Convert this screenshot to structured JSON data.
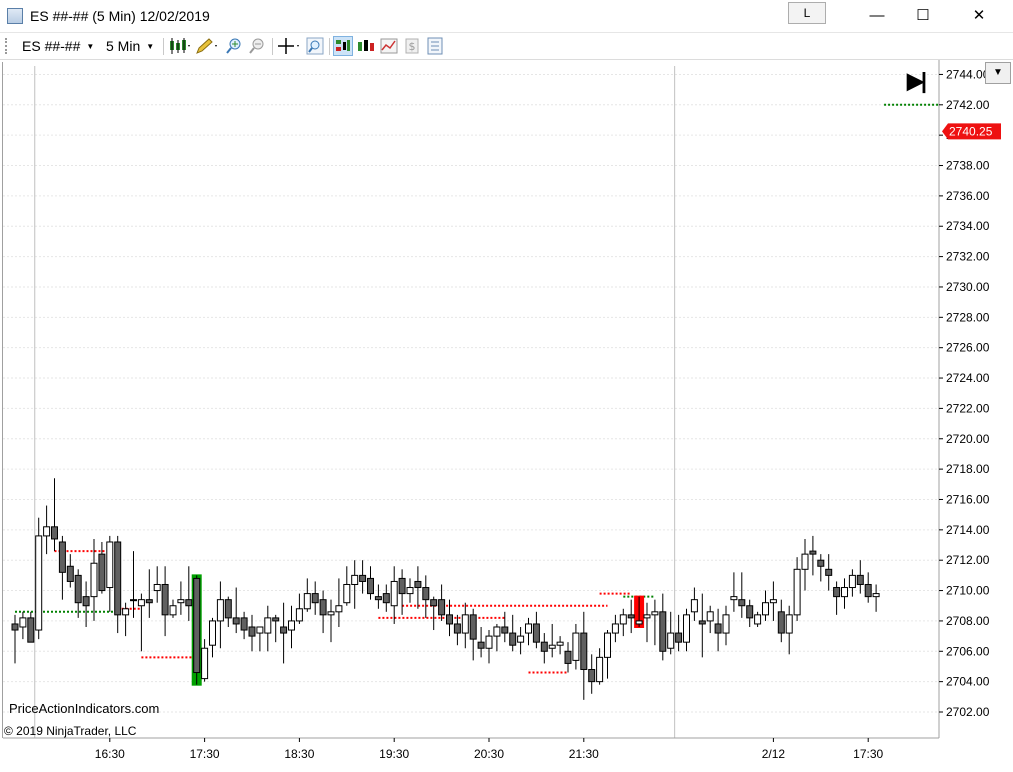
{
  "window": {
    "title": "ES ##-## (5 Min)  12/02/2019",
    "link_label": "L",
    "minimize_glyph": "—",
    "maximize_glyph": "☐",
    "close_glyph": "✕"
  },
  "toolbar": {
    "instrument": "ES ##-##",
    "interval": "5 Min",
    "icons": [
      "candlestick-chart-icon",
      "drawing-pencil-icon",
      "zoom-in-icon",
      "zoom-out-icon",
      "crosshair-icon",
      "magnifier-icon",
      "chart-trader-icon",
      "strategies-icon",
      "indicators-icon",
      "dollar-icon",
      "properties-icon"
    ]
  },
  "overlay": {
    "watermark": "PriceActionIndicators.com",
    "copyright": "© 2019 NinjaTrader, LLC",
    "go_to_end_glyph": "▶|"
  },
  "chart_data": {
    "type": "candlestick",
    "title": "",
    "ylim": [
      2700.5,
      2744.5
    ],
    "yticks": [
      2702,
      2704,
      2706,
      2708,
      2710,
      2712,
      2714,
      2716,
      2718,
      2720,
      2722,
      2724,
      2726,
      2728,
      2730,
      2732,
      2734,
      2736,
      2738,
      2740,
      2742,
      2744
    ],
    "ytick_labels": [
      "2702.00",
      "2704.00",
      "2706.00",
      "2708.00",
      "2710.00",
      "2712.00",
      "2714.00",
      "2716.00",
      "2718.00",
      "2720.00",
      "2722.00",
      "2724.00",
      "2726.00",
      "2728.00",
      "2730.00",
      "2732.00",
      "2734.00",
      "2736.00",
      "2738.00",
      "2740.00",
      "2742.00",
      "2744.00"
    ],
    "xticks": [
      {
        "i": 12,
        "label": "16:30"
      },
      {
        "i": 24,
        "label": "17:30"
      },
      {
        "i": 36,
        "label": "18:30"
      },
      {
        "i": 48,
        "label": "19:30"
      },
      {
        "i": 60,
        "label": "20:30"
      },
      {
        "i": 72,
        "label": "21:30"
      },
      {
        "i": 96,
        "label": "2/12"
      },
      {
        "i": 108,
        "label": "17:30"
      }
    ],
    "session_breaks": [
      2,
      83
    ],
    "last_price": 2740.25,
    "last_price_label": "2740.25",
    "colors": {
      "up": "#ffffff",
      "down": "#606060",
      "wick": "#000000",
      "red_level": "#ff0000",
      "green_level": "#008000",
      "highlight_red": "#ff0000",
      "highlight_green": "#00a000",
      "grid": "#e6e6e6"
    },
    "candles": [
      [
        2707.8,
        2708.4,
        2705.2,
        2707.4
      ],
      [
        2707.6,
        2708.6,
        2706.8,
        2708.2
      ],
      [
        2708.2,
        2708.6,
        2706.6,
        2706.6
      ],
      [
        2707.4,
        2714.8,
        2706.8,
        2713.6
      ],
      [
        2713.6,
        2715.6,
        2712.4,
        2714.2
      ],
      [
        2714.2,
        2717.4,
        2712.6,
        2713.4
      ],
      [
        2713.2,
        2713.6,
        2709.4,
        2711.2
      ],
      [
        2711.6,
        2712.4,
        2710.2,
        2710.6
      ],
      [
        2711.0,
        2711.4,
        2708.2,
        2709.2
      ],
      [
        2709.6,
        2710.6,
        2707.6,
        2709.0
      ],
      [
        2709.6,
        2713.4,
        2708.0,
        2711.8
      ],
      [
        2712.4,
        2713.2,
        2709.8,
        2710.0
      ],
      [
        2710.2,
        2713.6,
        2708.6,
        2713.2
      ],
      [
        2713.2,
        2713.6,
        2707.2,
        2708.4
      ],
      [
        2708.4,
        2709.2,
        2707.0,
        2708.8
      ],
      [
        2709.4,
        2712.6,
        2708.2,
        2709.4
      ],
      [
        2709.0,
        2709.8,
        2706.0,
        2709.4
      ],
      [
        2709.4,
        2711.4,
        2708.2,
        2709.2
      ],
      [
        2710.0,
        2711.6,
        2709.2,
        2710.4
      ],
      [
        2710.4,
        2711.6,
        2707.0,
        2708.4
      ],
      [
        2708.4,
        2709.4,
        2708.2,
        2709.0
      ],
      [
        2709.2,
        2710.6,
        2708.4,
        2709.4
      ],
      [
        2709.4,
        2711.6,
        2708.0,
        2709.0
      ],
      [
        2710.8,
        2711.0,
        2703.8,
        2704.6
      ],
      [
        2704.2,
        2706.8,
        2704.0,
        2706.2
      ],
      [
        2706.4,
        2708.2,
        2705.6,
        2708.0
      ],
      [
        2708.0,
        2710.6,
        2706.2,
        2709.4
      ],
      [
        2709.4,
        2709.6,
        2707.6,
        2708.2
      ],
      [
        2708.2,
        2710.2,
        2707.2,
        2707.8
      ],
      [
        2708.2,
        2708.6,
        2706.8,
        2707.4
      ],
      [
        2707.6,
        2708.4,
        2706.0,
        2707.0
      ],
      [
        2707.2,
        2707.6,
        2706.0,
        2707.6
      ],
      [
        2707.2,
        2709.0,
        2706.0,
        2708.2
      ],
      [
        2708.2,
        2708.4,
        2706.6,
        2708.0
      ],
      [
        2707.6,
        2709.2,
        2705.2,
        2707.2
      ],
      [
        2707.4,
        2709.0,
        2706.2,
        2708.0
      ],
      [
        2708.0,
        2709.8,
        2707.8,
        2708.8
      ],
      [
        2708.8,
        2710.8,
        2708.6,
        2709.8
      ],
      [
        2709.8,
        2710.6,
        2708.4,
        2709.2
      ],
      [
        2709.4,
        2710.0,
        2707.2,
        2708.4
      ],
      [
        2708.4,
        2709.4,
        2706.6,
        2708.6
      ],
      [
        2708.6,
        2710.8,
        2707.6,
        2709.0
      ],
      [
        2709.2,
        2711.6,
        2709.0,
        2710.4
      ],
      [
        2710.4,
        2712.0,
        2708.8,
        2711.0
      ],
      [
        2711.0,
        2712.0,
        2709.8,
        2710.6
      ],
      [
        2710.8,
        2711.6,
        2709.4,
        2709.8
      ],
      [
        2709.6,
        2710.4,
        2708.8,
        2709.4
      ],
      [
        2709.8,
        2710.4,
        2708.6,
        2709.2
      ],
      [
        2709.0,
        2711.6,
        2707.8,
        2710.6
      ],
      [
        2710.8,
        2711.4,
        2708.4,
        2709.8
      ],
      [
        2709.8,
        2710.8,
        2709.2,
        2710.2
      ],
      [
        2710.6,
        2711.6,
        2708.8,
        2710.2
      ],
      [
        2710.2,
        2711.0,
        2708.2,
        2709.4
      ],
      [
        2709.4,
        2709.6,
        2707.4,
        2709.0
      ],
      [
        2709.4,
        2710.4,
        2708.0,
        2708.4
      ],
      [
        2708.4,
        2709.4,
        2707.0,
        2707.8
      ],
      [
        2707.8,
        2708.4,
        2706.4,
        2707.2
      ],
      [
        2707.2,
        2709.2,
        2706.2,
        2708.4
      ],
      [
        2708.4,
        2708.8,
        2705.4,
        2706.8
      ],
      [
        2706.6,
        2707.6,
        2705.6,
        2706.2
      ],
      [
        2706.2,
        2707.4,
        2705.2,
        2707.0
      ],
      [
        2707.0,
        2707.8,
        2706.0,
        2707.6
      ],
      [
        2707.6,
        2708.6,
        2706.6,
        2707.2
      ],
      [
        2707.2,
        2708.4,
        2706.0,
        2706.4
      ],
      [
        2706.6,
        2707.6,
        2705.8,
        2707.0
      ],
      [
        2707.2,
        2708.2,
        2706.4,
        2707.8
      ],
      [
        2707.8,
        2708.6,
        2706.2,
        2706.6
      ],
      [
        2706.6,
        2707.2,
        2705.2,
        2706.0
      ],
      [
        2706.2,
        2707.8,
        2705.6,
        2706.4
      ],
      [
        2706.4,
        2707.0,
        2705.8,
        2706.6
      ],
      [
        2706.0,
        2706.6,
        2704.6,
        2705.2
      ],
      [
        2705.4,
        2707.8,
        2704.8,
        2707.2
      ],
      [
        2707.2,
        2708.6,
        2702.8,
        2704.8
      ],
      [
        2704.8,
        2705.8,
        2703.2,
        2704.0
      ],
      [
        2704.0,
        2706.2,
        2703.8,
        2705.6
      ],
      [
        2705.6,
        2707.4,
        2704.2,
        2707.2
      ],
      [
        2707.2,
        2708.4,
        2706.6,
        2707.8
      ],
      [
        2707.8,
        2708.8,
        2707.0,
        2708.4
      ],
      [
        2708.4,
        2709.4,
        2707.2,
        2708.2
      ],
      [
        2707.8,
        2709.6,
        2707.6,
        2708.0
      ],
      [
        2708.2,
        2709.2,
        2706.6,
        2708.4
      ],
      [
        2708.4,
        2709.4,
        2706.4,
        2708.6
      ],
      [
        2708.6,
        2709.8,
        2705.4,
        2706.0
      ],
      [
        2706.2,
        2708.6,
        2705.8,
        2707.2
      ],
      [
        2707.2,
        2708.4,
        2706.0,
        2706.6
      ],
      [
        2706.6,
        2708.8,
        2706.0,
        2708.4
      ],
      [
        2708.6,
        2710.2,
        2708.0,
        2709.4
      ],
      [
        2708.0,
        2709.8,
        2705.6,
        2707.8
      ],
      [
        2708.0,
        2709.0,
        2707.2,
        2708.6
      ],
      [
        2707.8,
        2708.8,
        2706.0,
        2707.2
      ],
      [
        2707.2,
        2709.0,
        2706.4,
        2708.4
      ],
      [
        2709.4,
        2711.2,
        2708.6,
        2709.6
      ],
      [
        2709.4,
        2711.2,
        2708.2,
        2709.0
      ],
      [
        2709.0,
        2709.4,
        2707.6,
        2708.2
      ],
      [
        2707.8,
        2708.6,
        2707.6,
        2708.4
      ],
      [
        2708.4,
        2710.0,
        2708.0,
        2709.2
      ],
      [
        2709.2,
        2710.6,
        2708.0,
        2709.4
      ],
      [
        2708.6,
        2709.4,
        2706.6,
        2707.2
      ],
      [
        2707.2,
        2709.0,
        2705.8,
        2708.4
      ],
      [
        2708.4,
        2712.2,
        2708.0,
        2711.4
      ],
      [
        2711.4,
        2713.4,
        2710.0,
        2712.4
      ],
      [
        2712.6,
        2713.6,
        2711.0,
        2712.4
      ],
      [
        2712.0,
        2712.4,
        2710.6,
        2711.6
      ],
      [
        2711.4,
        2712.4,
        2710.0,
        2711.0
      ],
      [
        2710.2,
        2710.6,
        2708.4,
        2709.6
      ],
      [
        2709.6,
        2710.8,
        2708.8,
        2710.2
      ],
      [
        2710.2,
        2711.4,
        2709.6,
        2711.0
      ],
      [
        2711.0,
        2712.0,
        2709.8,
        2710.4
      ],
      [
        2710.4,
        2711.2,
        2709.2,
        2709.6
      ],
      [
        2709.6,
        2710.4,
        2708.6,
        2709.8
      ]
    ],
    "levels": [
      {
        "color": "red",
        "price": 2712.6,
        "i0": 5,
        "i1": 13
      },
      {
        "color": "green",
        "price": 2708.6,
        "i0": 0,
        "i1": 13
      },
      {
        "color": "red",
        "price": 2708.8,
        "i0": 13,
        "i1": 16
      },
      {
        "color": "red",
        "price": 2705.6,
        "i0": 16,
        "i1": 24
      },
      {
        "color": "red",
        "price": 2708.2,
        "i0": 46,
        "i1": 62
      },
      {
        "color": "red",
        "price": 2709.0,
        "i0": 49,
        "i1": 75
      },
      {
        "color": "red",
        "price": 2709.8,
        "i0": 74,
        "i1": 78
      },
      {
        "color": "green",
        "price": 2709.6,
        "i0": 77,
        "i1": 81
      },
      {
        "color": "red",
        "price": 2704.6,
        "i0": 65,
        "i1": 70
      }
    ],
    "highlights": [
      {
        "i": 23,
        "color": "green"
      },
      {
        "i": 79,
        "color": "red"
      }
    ]
  }
}
